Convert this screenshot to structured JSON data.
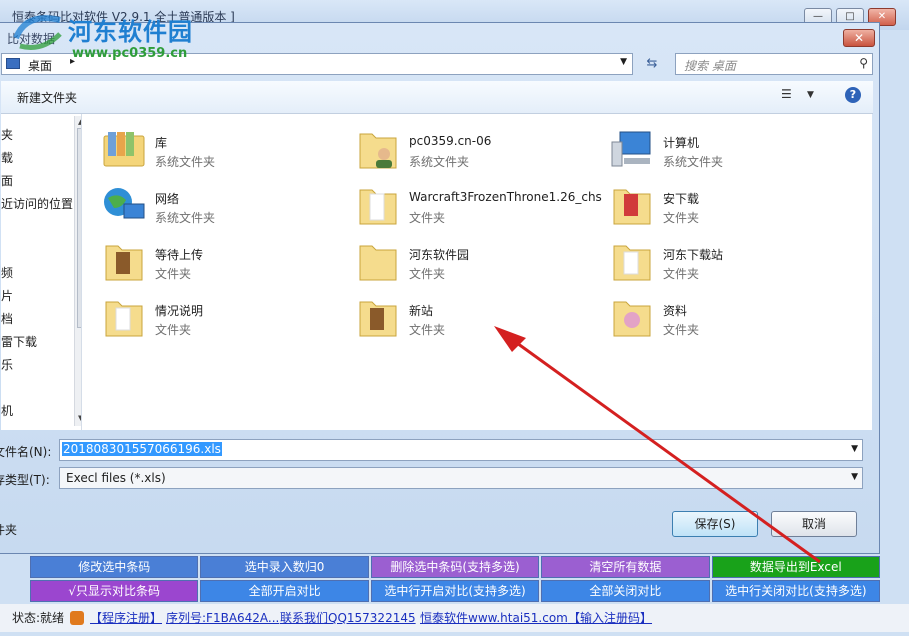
{
  "bg_window": {
    "title": "恒泰条码比对软件 V2.9.1 全土普通版本 ]",
    "buttons_row1": [
      {
        "label": "修改选中条码",
        "color": "#4a7fd6"
      },
      {
        "label": "选中录入数归0",
        "color": "#4a7fd6"
      },
      {
        "label": "删除选中条码(支持多选)",
        "color": "#9b5fd1"
      },
      {
        "label": "清空所有数据",
        "color": "#9b5fd1"
      },
      {
        "label": "数据导出到Excel",
        "color": "#19a21a"
      }
    ],
    "buttons_row2": [
      {
        "label": "√只显示对比条码",
        "color": "#9b46cf"
      },
      {
        "label": "全部开启对比",
        "color": "#3d86e6"
      },
      {
        "label": "选中行开启对比(支持多选)",
        "color": "#3d86e6"
      },
      {
        "label": "全部关闭对比",
        "color": "#3d86e6"
      },
      {
        "label": "选中行关闭对比(支持多选)",
        "color": "#3d86e6"
      }
    ],
    "status": {
      "label": "状态:就绪",
      "register": "【程序注册】",
      "serial": "序列号:F1BA642A...",
      "contact": "联系我们QQ157322145",
      "website": "恒泰软件www.htai51.com",
      "enter_code": "【输入注册码】"
    }
  },
  "dialog": {
    "title": "比对数据",
    "address": "桌面",
    "search_placeholder": "搜索 桌面",
    "new_folder": "新建文件夹",
    "nav_items": [
      "夹",
      "载",
      "面",
      "近访问的位置",
      "",
      "",
      "频",
      "片",
      "档",
      "雷下载",
      "乐",
      "",
      "机"
    ],
    "items": [
      {
        "name": "库",
        "type": "系统文件夹",
        "icon": "library-icon"
      },
      {
        "name": "pc0359.cn-06",
        "type": "系统文件夹",
        "icon": "user-folder-icon"
      },
      {
        "name": "计算机",
        "type": "系统文件夹",
        "icon": "computer-icon"
      },
      {
        "name": "网络",
        "type": "系统文件夹",
        "icon": "network-icon"
      },
      {
        "name": "Warcraft3FrozenThrone1.26_chs",
        "type": "文件夹",
        "icon": "folder-icon"
      },
      {
        "name": "安下载",
        "type": "文件夹",
        "icon": "folder-icon"
      },
      {
        "name": "等待上传",
        "type": "文件夹",
        "icon": "folder-icon"
      },
      {
        "name": "河东软件园",
        "type": "文件夹",
        "icon": "folder-icon"
      },
      {
        "name": "河东下载站",
        "type": "文件夹",
        "icon": "folder-icon"
      },
      {
        "name": "情况说明",
        "type": "文件夹",
        "icon": "folder-icon"
      },
      {
        "name": "新站",
        "type": "文件夹",
        "icon": "folder-icon"
      },
      {
        "name": "资料",
        "type": "文件夹",
        "icon": "folder-icon"
      }
    ],
    "filename_label": "文件名(N):",
    "filename_value": "201808301557066196.xls",
    "filetype_label": "存类型(T):",
    "filetype_value": "Execl files (*.xls)",
    "hide_folders": "件夹",
    "save_label": "保存(S)",
    "cancel_label": "取消"
  },
  "watermark": {
    "text": "河东软件园",
    "url": "www.pc0359.cn"
  },
  "annotation": {
    "color": "#d42020"
  }
}
